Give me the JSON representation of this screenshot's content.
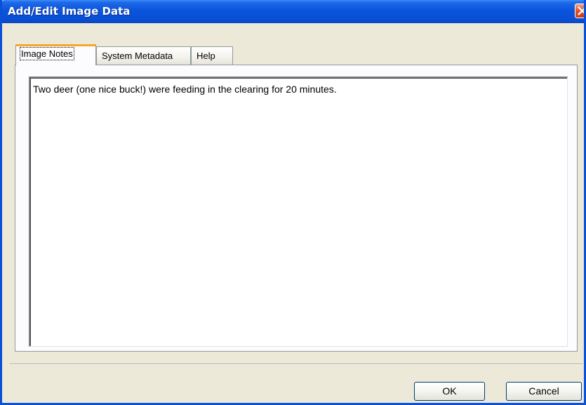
{
  "window": {
    "title": "Add/Edit Image Data"
  },
  "tabs": [
    {
      "label": "Image Notes",
      "active": true
    },
    {
      "label": "System Metadata",
      "active": false
    },
    {
      "label": "Help",
      "active": false
    }
  ],
  "notes": {
    "value": "Two deer (one nice buck!) were feeding in the clearing for 20 minutes."
  },
  "buttons": {
    "ok": "OK",
    "cancel": "Cancel"
  },
  "colors": {
    "titlebar": "#0a4fd6",
    "active_tab_accent": "#f5a726",
    "close_button": "#e0582f"
  }
}
